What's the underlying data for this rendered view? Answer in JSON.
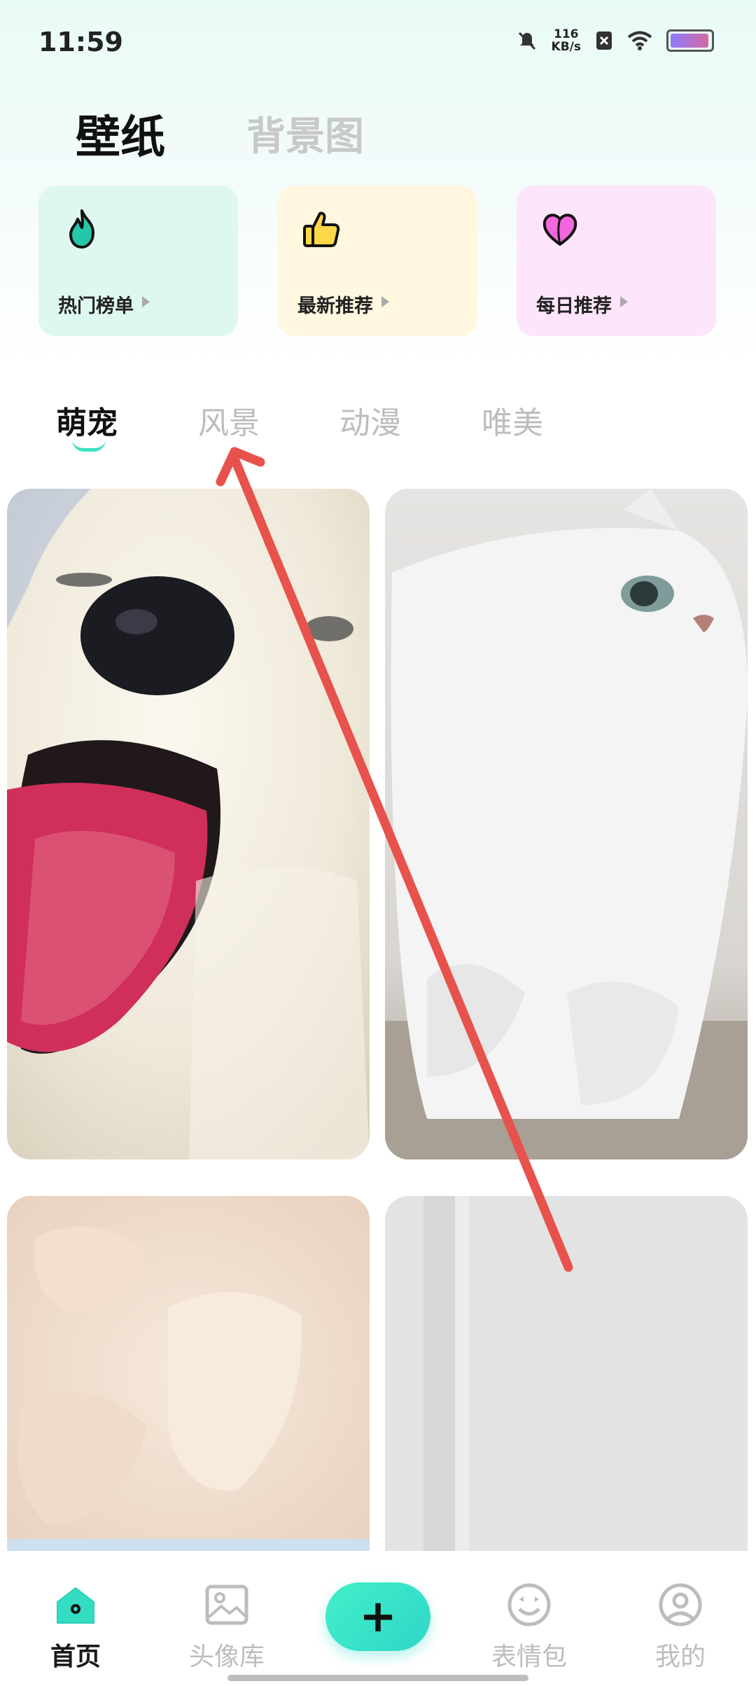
{
  "status_bar": {
    "time": "11:59",
    "net_speed_value": "116",
    "net_speed_unit": "KB/s"
  },
  "header": {
    "tabs": [
      {
        "label": "壁纸",
        "active": true
      },
      {
        "label": "背景图",
        "active": false
      }
    ]
  },
  "quick_cards": [
    {
      "label": "热门榜单",
      "icon": "flame-icon",
      "bg": "#def8f0"
    },
    {
      "label": "最新推荐",
      "icon": "thumbs-up-icon",
      "bg": "#fff7df"
    },
    {
      "label": "每日推荐",
      "icon": "heart-icon",
      "bg": "#fde6fc"
    }
  ],
  "category_tabs": [
    {
      "label": "萌宠",
      "active": true
    },
    {
      "label": "风景",
      "active": false
    },
    {
      "label": "动漫",
      "active": false
    },
    {
      "label": "唯美",
      "active": false
    }
  ],
  "bottom_nav": [
    {
      "label": "首页",
      "icon": "home-icon",
      "active": true
    },
    {
      "label": "头像库",
      "icon": "image-icon",
      "active": false
    },
    {
      "label": "表情包",
      "icon": "smile-icon",
      "active": false
    },
    {
      "label": "我的",
      "icon": "profile-icon",
      "active": false
    }
  ],
  "fab": {
    "label": "+"
  },
  "colors": {
    "accent": "#3ce0c4"
  }
}
